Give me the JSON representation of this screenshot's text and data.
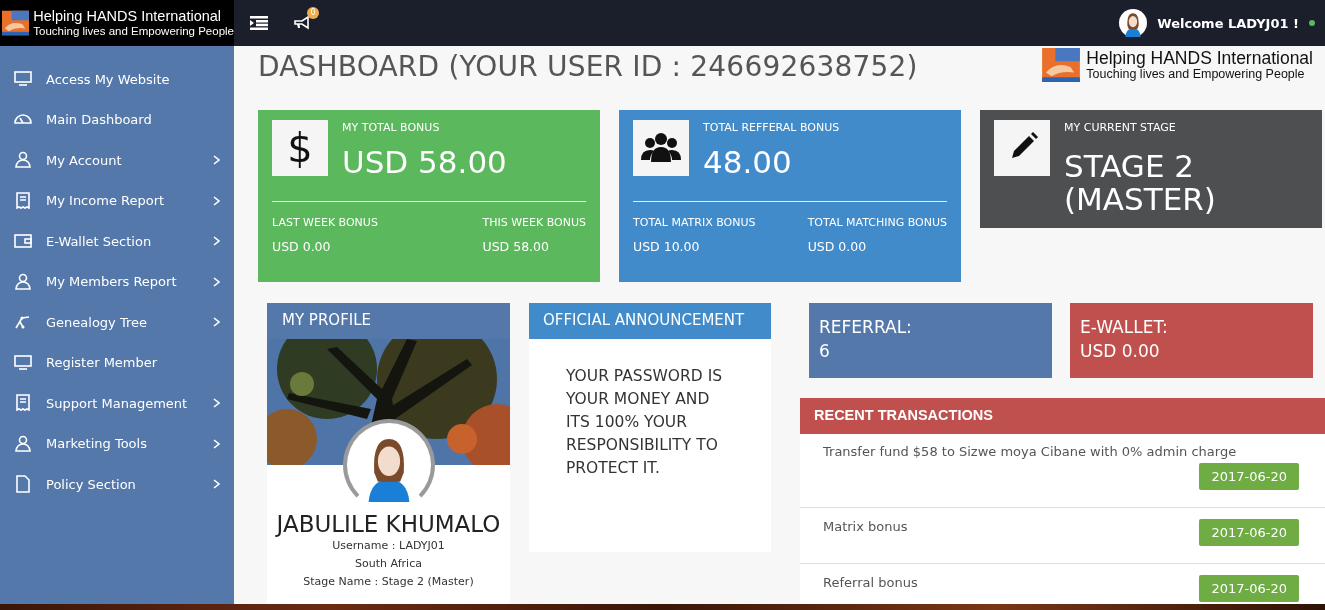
{
  "topbar": {
    "brand_title": "Helping HANDS International",
    "brand_tagline": "Touching lives and Empowering People",
    "notification_count": "0",
    "welcome": "Welcome LADYJ01 !",
    "online": true
  },
  "sidebar": {
    "items": [
      {
        "label": "Access My Website",
        "expandable": false
      },
      {
        "label": "Main Dashboard",
        "expandable": false
      },
      {
        "label": "My Account",
        "expandable": true
      },
      {
        "label": "My Income Report",
        "expandable": true
      },
      {
        "label": "E-Wallet Section",
        "expandable": true
      },
      {
        "label": "My Members Report",
        "expandable": true
      },
      {
        "label": "Genealogy Tree",
        "expandable": true
      },
      {
        "label": "Register Member",
        "expandable": false
      },
      {
        "label": "Support Management",
        "expandable": true
      },
      {
        "label": "Marketing Tools",
        "expandable": true
      },
      {
        "label": "Policy Section",
        "expandable": true
      }
    ]
  },
  "header": {
    "title": "DASHBOARD (YOUR USER ID : 246692638752)",
    "brand_title": "Helping HANDS International",
    "brand_tagline": "Touching lives and Empowering People"
  },
  "stat_cards": [
    {
      "kind": "split",
      "color": "#5cb85c",
      "icon_text": "$",
      "title": "MY TOTAL BONUS",
      "value": "USD 58.00",
      "left_label": "LAST WEEK BONUS",
      "left_value": "USD 0.00",
      "right_label": "THIS WEEK BONUS",
      "right_value": "USD 58.00"
    },
    {
      "kind": "split",
      "color": "#428bca",
      "title": "TOTAL REFFERAL BONUS",
      "value": "48.00",
      "left_label": "TOTAL MATRIX BONUS",
      "left_value": "USD 10.00",
      "right_label": "TOTAL MATCHING BONUS",
      "right_value": "USD 0.00"
    },
    {
      "kind": "plain",
      "color": "#4d4f51",
      "title": "MY CURRENT STAGE",
      "value": "STAGE 2 (MASTER)"
    }
  ],
  "profile": {
    "heading": "MY PROFILE",
    "name": "JABULILE KHUMALO",
    "username": "Username : LADYJ01",
    "country": "South Africa",
    "stage": "Stage Name : Stage 2 (Master)"
  },
  "announcement": {
    "heading": "OFFICIAL ANNOUNCEMENT",
    "text": "YOUR PASSWORD IS YOUR MONEY AND ITS 100% YOUR RESPONSIBILITY TO PROTECT IT."
  },
  "summary_cards": [
    {
      "label": "REFERRAL:",
      "value": "6",
      "color": "#5578ab"
    },
    {
      "label": "E-WALLET:",
      "value": "USD 0.00",
      "color": "#c0504d"
    }
  ],
  "transactions": {
    "heading": "RECENT TRANSACTIONS",
    "rows": [
      {
        "text": "Transfer fund $58 to Sizwe moya Cibane with 0% admin charge",
        "date": "2017-06-20"
      },
      {
        "text": "Matrix bonus",
        "date": "2017-06-20"
      },
      {
        "text": "Referral bonus",
        "date": "2017-06-20"
      }
    ]
  }
}
